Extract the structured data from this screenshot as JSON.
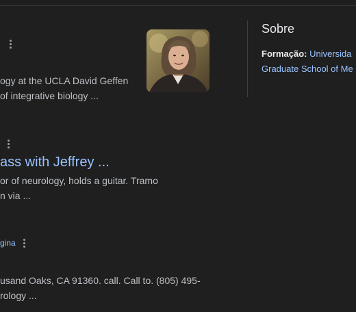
{
  "results": {
    "r1": {
      "snippet_line1": "ogy at the UCLA David Geffen",
      "snippet_line2": "of integrative biology ..."
    },
    "r2": {
      "title": "ass with Jeffrey ...",
      "snippet_line1": "or of neurology, holds a guitar. Tramo",
      "snippet_line2": "n via ..."
    },
    "r3": {
      "link_fragment": "gina",
      "snippet_line1": "usand Oaks, CA 91360. call. Call to. (805) 495-",
      "snippet_line2": "rology ..."
    }
  },
  "knowledge_panel": {
    "title": "Sobre",
    "education_label": "Formação:",
    "education_value_line1": "Universida",
    "education_value_line2": "Graduate School of Me"
  },
  "icons": {
    "more_options": "more-vert-icon"
  },
  "colors": {
    "background": "#1f1f1f",
    "link": "#99c3ff",
    "text": "#bdc1c6",
    "heading": "#e8eaed",
    "divider": "#3c4043"
  }
}
